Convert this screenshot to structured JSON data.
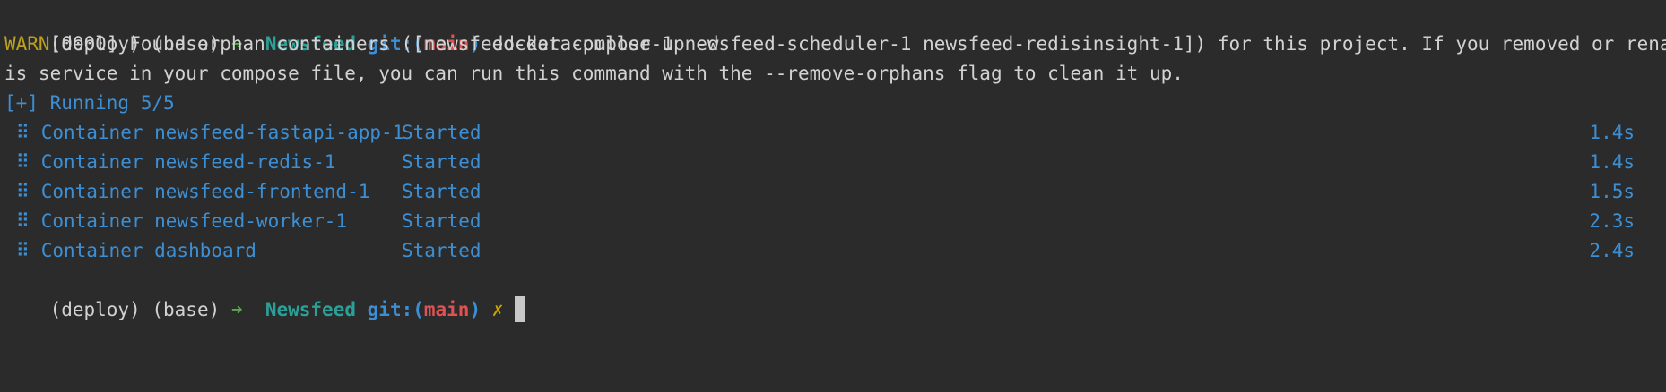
{
  "colors": {
    "background": "#2b2b2b",
    "text": "#d2d2d2",
    "arrow": "#5ba94f",
    "directory": "#2aa198",
    "git_label": "#3b8fd6",
    "branch": "#e05252",
    "dirty_mark": "#c8a400",
    "warn": "#bda11c",
    "info": "#3d8fd4"
  },
  "prompt": {
    "env": "(deploy) (base)",
    "arrow": "➜",
    "directory": "Newsfeed",
    "git_label": "git:(",
    "branch": "main",
    "git_close": ")",
    "dirty_mark": "✗"
  },
  "command": "docker compose up -d",
  "warning": {
    "tag": "WARN",
    "line1_rest": "[0000] Found orphan containers ([newsfeed-data-puller-1 newsfeed-scheduler-1 newsfeed-redisinsight-1]) for this project. If you removed or renamed th",
    "line2": "is service in your compose file, you can run this command with the --remove-orphans flag to clean it up."
  },
  "running": "[+] Running 5/5",
  "containers": [
    {
      "icon": "⠿",
      "name": "Container newsfeed-fastapi-app-1",
      "status": "Started",
      "time": "1.4s"
    },
    {
      "icon": "⠿",
      "name": "Container newsfeed-redis-1",
      "status": "Started",
      "time": "1.4s"
    },
    {
      "icon": "⠿",
      "name": "Container newsfeed-frontend-1",
      "status": "Started",
      "time": "1.5s"
    },
    {
      "icon": "⠿",
      "name": "Container newsfeed-worker-1",
      "status": "Started",
      "time": "2.3s"
    },
    {
      "icon": "⠿",
      "name": "Container dashboard",
      "status": "Started",
      "time": "2.4s"
    }
  ]
}
